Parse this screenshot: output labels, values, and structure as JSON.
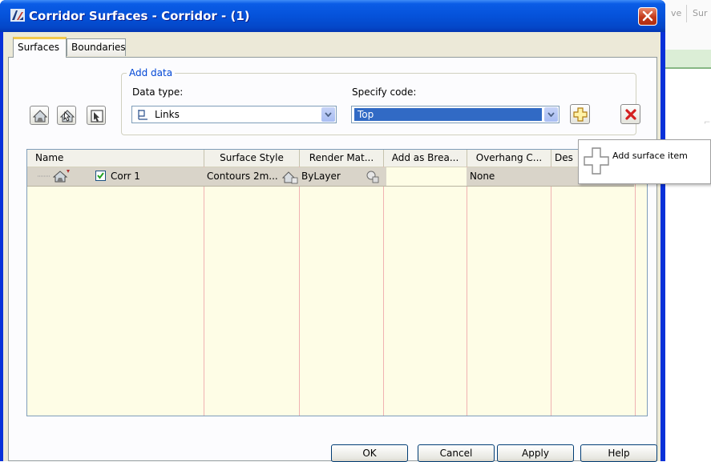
{
  "window": {
    "title": "Corridor Surfaces - Corridor - (1)"
  },
  "background_app": {
    "tab_fragments": [
      "ve",
      "Sur"
    ]
  },
  "tabs": [
    {
      "label": "Surfaces",
      "active": true
    },
    {
      "label": "Boundaries",
      "active": false
    }
  ],
  "add_data": {
    "legend": "Add data",
    "data_type_label": "Data type:",
    "data_type_value": "Links",
    "specify_code_label": "Specify code:",
    "specify_code_value": "Top"
  },
  "toolbar_icons": [
    "create-surface-icon",
    "pick-surface-icon",
    "select-boundary-icon"
  ],
  "grid": {
    "columns": [
      "Name",
      "Surface Style",
      "Render Mat...",
      "Add as Brea...",
      "Overhang C...",
      "Des"
    ],
    "rows": [
      {
        "name": "Corr 1",
        "checked": true,
        "surface_style": "Contours 2m...",
        "render_material": "ByLayer",
        "add_as_breakline": "",
        "overhang_correction": "None",
        "description": ""
      }
    ]
  },
  "tooltip": {
    "text": "Add surface item"
  },
  "buttons": {
    "ok": "OK",
    "cancel": "Cancel",
    "apply": "Apply",
    "help": "Help"
  },
  "colors": {
    "title_bar": "#0552da",
    "dialog_bg": "#ece9d8",
    "grid_bg": "#fefde6",
    "selected_combo": "#316ac5",
    "delete_red": "#d42020"
  }
}
